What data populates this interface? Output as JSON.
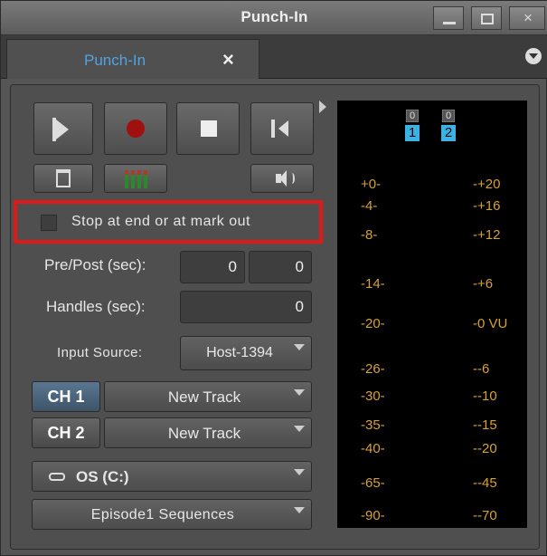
{
  "window": {
    "title": "Punch-In"
  },
  "tab": {
    "label": "Punch-In",
    "close": "×"
  },
  "controls": {
    "stop_at_end_label": "Stop at end or at mark out",
    "stop_at_end_checked": false,
    "prepost_label": "Pre/Post (sec):",
    "pre_value": "0",
    "post_value": "0",
    "handles_label": "Handles (sec):",
    "handles_value": "0",
    "input_source_label": "Input Source:",
    "input_source_value": "Host-1394",
    "channels": [
      {
        "name": "CH 1",
        "track": "New Track"
      },
      {
        "name": "CH 2",
        "track": "New Track"
      }
    ],
    "drive_value": "OS (C:)",
    "bin_value": "Episode1 Sequences"
  },
  "meter": {
    "clip_indicators": [
      "0",
      "0"
    ],
    "channel_numbers": [
      "1",
      "2"
    ],
    "left_scale": [
      "+0-",
      "-4-",
      "-8-",
      "-14-",
      "-20-",
      "-26-",
      "-30-",
      "-35-",
      "-40-",
      "-65-",
      "-90-"
    ],
    "right_scale": [
      "-+20",
      "-+16",
      "-+12",
      "-+6",
      "-0 VU",
      "--6",
      "--10",
      "--15",
      "--20",
      "--45",
      "--70"
    ],
    "scale_color": "#d6a13a",
    "channel_color": "#3ab2e6"
  },
  "icons": {
    "transport": [
      "play-icon",
      "record-icon",
      "stop-icon",
      "mark-in-icon"
    ],
    "secondary": [
      "trash-icon",
      "meters-icon",
      "speaker-icon"
    ]
  },
  "colors": {
    "highlight_box": "#e01818",
    "tab_label": "#4fa3e0",
    "record": "#a01010"
  }
}
